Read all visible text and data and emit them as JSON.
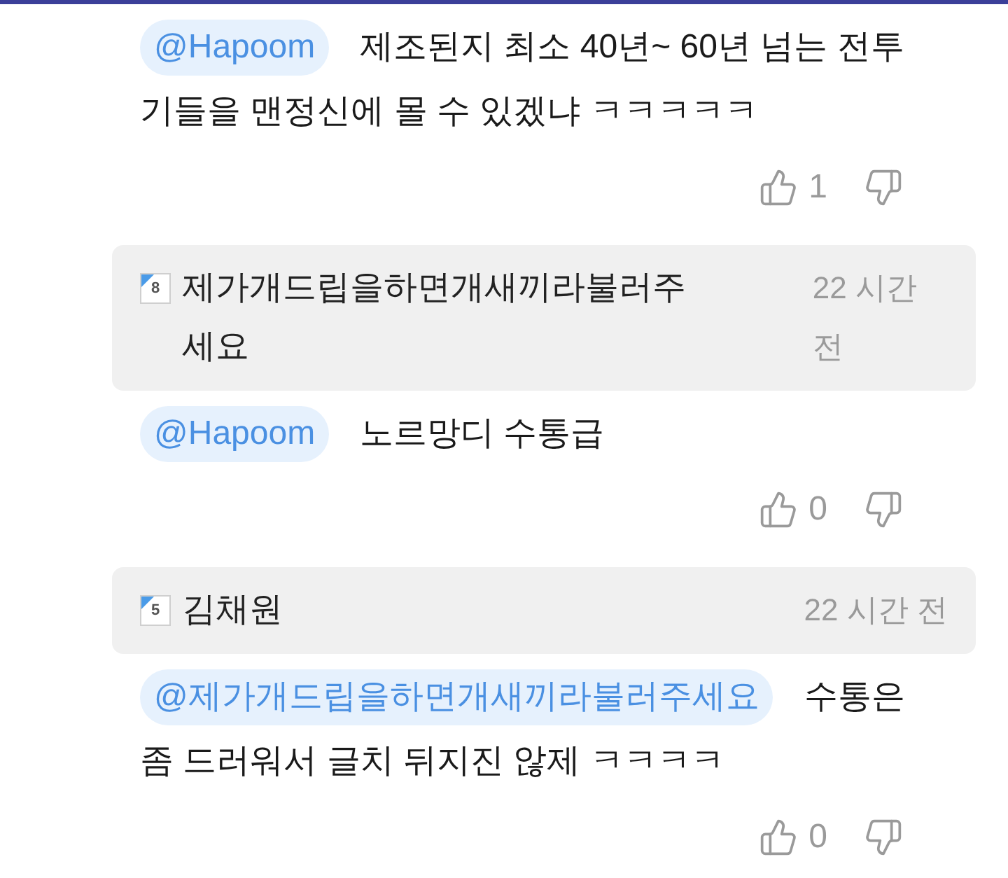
{
  "comments": [
    {
      "mention": "@Hapoom",
      "body": "제조된지 최소 40년~ 60년 넘는 전투기들을 맨정신에 몰 수 있겠냐 ㅋㅋㅋㅋㅋ",
      "likes": "1"
    },
    {
      "header": {
        "badge": "8",
        "author": "제가개드립을하면개새끼라불러주세요",
        "time": "22 시간 전"
      },
      "mention": "@Hapoom",
      "body": "노르망디 수통급",
      "likes": "0"
    },
    {
      "header": {
        "badge": "5",
        "author": "김채원",
        "time": "22 시간 전"
      },
      "mention": "@제가개드립을하면개새끼라불러주세요",
      "body": "수통은 좀 드러워서 글치 뒤지진 않제 ㅋㅋㅋㅋ",
      "likes": "0"
    }
  ]
}
